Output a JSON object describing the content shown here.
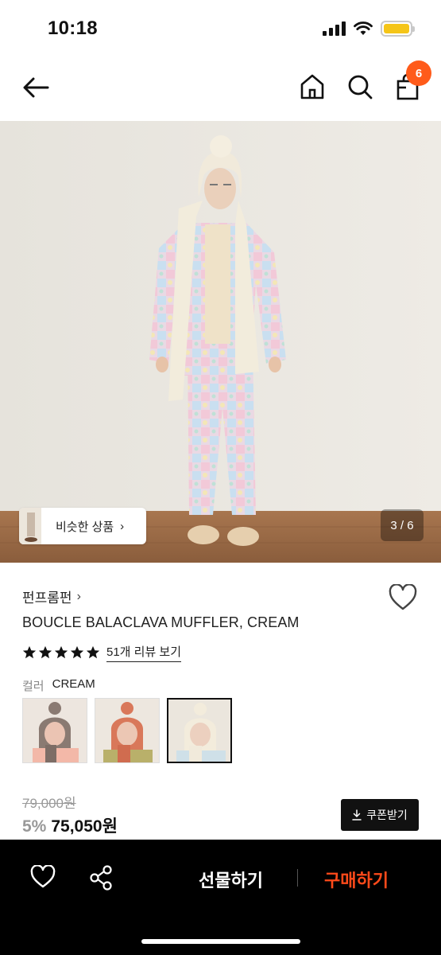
{
  "status": {
    "time": "10:18"
  },
  "header": {
    "cart_count": "6"
  },
  "gallery": {
    "similar_label": "비슷한 상품",
    "similar_chevron": "›",
    "counter": "3 / 6"
  },
  "product": {
    "brand": "펀프롬펀",
    "brand_chevron": "›",
    "title": "BOUCLE BALACLAVA MUFFLER, CREAM",
    "rating_stars": 5,
    "review_link": "51개 리뷰 보기",
    "color_label": "컬러",
    "color_value": "CREAM",
    "swatches": [
      "gray",
      "orange",
      "cream"
    ],
    "selected_swatch": "cream",
    "original_price": "79,000원",
    "discount": "5%",
    "price": "75,050원",
    "coupon_label": "쿠폰받기"
  },
  "bottom_bar": {
    "gift_label": "선물하기",
    "buy_label": "구매하기"
  },
  "colors": {
    "accent": "#ff4a1a",
    "badge": "#ff5b1a",
    "battery": "#f5c518",
    "bar": "#000000"
  }
}
